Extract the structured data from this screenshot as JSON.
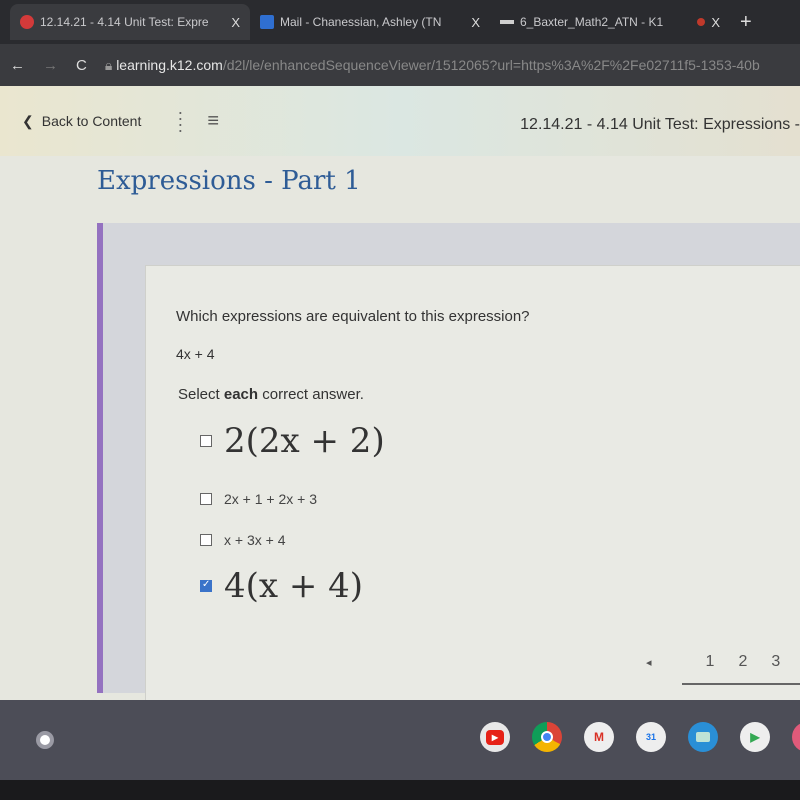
{
  "browser": {
    "tabs": [
      {
        "title": "12.14.21 - 4.14 Unit Test: Expre",
        "icon": "k12-icon",
        "color": "#d33a3a"
      },
      {
        "title": "Mail - Chanessian, Ashley (TN",
        "icon": "outlook-icon",
        "color": "#2f6fd1"
      },
      {
        "title": "6_Baxter_Math2_ATN - K1",
        "icon": "doc-icon",
        "color": "#cfcfcf"
      }
    ],
    "close_label": "X",
    "new_tab_label": "+",
    "url_host": "learning.k12.com",
    "url_path": "/d2l/le/enhancedSequenceViewer/1512065?url=https%3A%2F%2Fe02711f5-1353-40b"
  },
  "nav": {
    "back_label": "Back to Content",
    "title": "12.14.21 - 4.14 Unit Test: Expressions -"
  },
  "subtitle": "Expressions - Part 1",
  "question": {
    "prompt": "Which expressions are equivalent to this expression?",
    "expression": "4x + 4",
    "instruction_pre": "Select ",
    "instruction_bold": "each",
    "instruction_post": " correct answer.",
    "options": [
      {
        "label": "2(2x + 2)",
        "checked": false
      },
      {
        "label": "2x + 1 + 2x + 3",
        "checked": false
      },
      {
        "label": "x + 3x + 4",
        "checked": false
      },
      {
        "label": "4(x + 4)",
        "checked": true
      }
    ]
  },
  "pager": {
    "prev": "◂",
    "pages": [
      "1",
      "2",
      "3"
    ]
  },
  "shelf": {
    "apps": [
      "youtube-icon",
      "chrome-icon",
      "gmail-icon",
      "calendar-icon",
      "files-icon",
      "play-store-icon"
    ],
    "calendar_day": "31"
  }
}
